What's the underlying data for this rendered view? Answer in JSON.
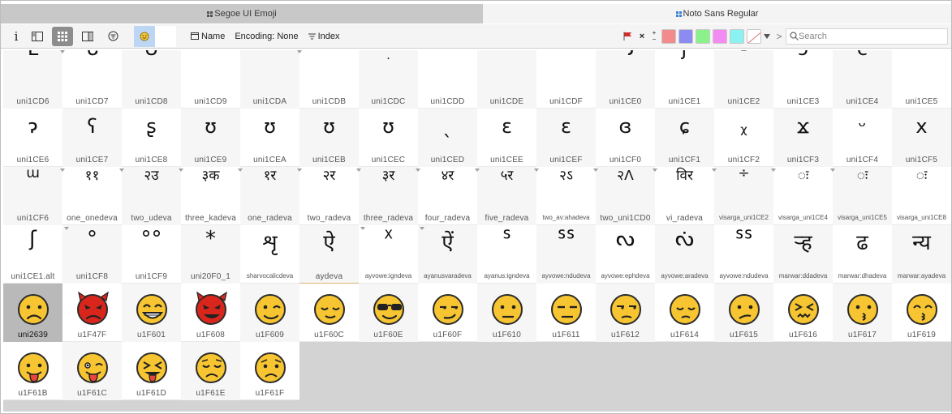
{
  "tabs": [
    {
      "label": "Segoe UI Emoji",
      "active": false
    },
    {
      "label": "Noto Sans Regular",
      "active": true
    }
  ],
  "toolbar": {
    "info_label": "i",
    "name_label": "Name",
    "encoding_label": "Encoding: None",
    "index_label": "Index",
    "plus_label": "+",
    "minus_label": "−",
    "close_label": "×",
    "next_label": ">",
    "search_placeholder": "Search",
    "swatch_colors": [
      "#f28b8b",
      "#8b8bf2",
      "#8bf28b",
      "#f28bf2",
      "#8bf2f2"
    ]
  },
  "colors": {
    "flag": "#d42a2a",
    "selected_cell": "#b9b9b9",
    "emoji_yellow": "#f7c531",
    "emoji_red": "#d9261c"
  },
  "rows": [
    [
      {
        "g": "ᒪ",
        "n": "uni1CD6"
      },
      {
        "g": "ᒐ",
        "n": "uni1CD7"
      },
      {
        "g": "ᑌ",
        "n": "uni1CD8"
      },
      {
        "g": "^",
        "n": "uni1CD9"
      },
      {
        "g": "\"",
        "n": "uni1CDA"
      },
      {
        "g": "‴",
        "n": "uni1CDB"
      },
      {
        "g": "ׅ",
        "n": "uni1CDC"
      },
      {
        "g": "·",
        "n": "uni1CDD"
      },
      {
        "g": "··",
        "n": "uni1CDE"
      },
      {
        "g": "···",
        "n": "uni1CDF"
      },
      {
        "g": "ᓓ",
        "n": "uni1CE0"
      },
      {
        "g": "ʃ",
        "n": "uni1CE1"
      },
      {
        "g": "-",
        "n": "uni1CE2"
      },
      {
        "g": "ɔ",
        "n": "uni1CE3"
      },
      {
        "g": "c",
        "n": "uni1CE4"
      },
      {
        "g": "ᑦ",
        "n": "uni1CE5"
      }
    ],
    [
      {
        "g": "ɂ",
        "n": "uni1CE6"
      },
      {
        "g": "ʕ",
        "n": "uni1CE7"
      },
      {
        "g": "ʂ",
        "n": "uni1CE8"
      },
      {
        "g": "ʊ",
        "n": "uni1CE9"
      },
      {
        "g": "ʊ",
        "n": "uni1CEA"
      },
      {
        "g": "ʊ",
        "n": "uni1CEB"
      },
      {
        "g": "ʊ",
        "n": "uni1CEC"
      },
      {
        "g": "ˎ",
        "n": "uni1CED"
      },
      {
        "g": "ɛ",
        "n": "uni1CEE"
      },
      {
        "g": "ɛ",
        "n": "uni1CEF"
      },
      {
        "g": "ɞ",
        "n": "uni1CF0"
      },
      {
        "g": "ɕ",
        "n": "uni1CF1"
      },
      {
        "g": "ᵪ",
        "n": "uni1CF2"
      },
      {
        "g": "ϫ",
        "n": "uni1CF3"
      },
      {
        "g": "ᵕ",
        "n": "uni1CF4"
      },
      {
        "g": "x",
        "n": "uni1CF5"
      }
    ],
    [
      {
        "g": "ɯ",
        "n": "uni1CF6"
      },
      {
        "g": "११",
        "n": "one_onedeva"
      },
      {
        "g": "२उ",
        "n": "two_udeva"
      },
      {
        "g": "३क",
        "n": "three_kadeva"
      },
      {
        "g": "१र",
        "n": "one_radeva"
      },
      {
        "g": "२र",
        "n": "two_radeva"
      },
      {
        "g": "३र",
        "n": "three_radeva"
      },
      {
        "g": "४र",
        "n": "four_radeva"
      },
      {
        "g": "५र",
        "n": "five_radeva"
      },
      {
        "g": "२ऽ",
        "n": "two_av:ahadeva"
      },
      {
        "g": "२ᐱ",
        "n": "two_uni1CD0"
      },
      {
        "g": "विर",
        "n": "vi_radeva"
      },
      {
        "g": "÷",
        "n": "visarga_uni1CE2"
      },
      {
        "g": "ः",
        "n": "visarga_uni1CE4"
      },
      {
        "g": "ः",
        "n": "visarga_uni1CE5"
      },
      {
        "g": "ः",
        "n": "visarga_uni1CE8"
      }
    ],
    [
      {
        "g": "ʃ",
        "n": "uni1CE1.alt"
      },
      {
        "g": "°",
        "n": "uni1CF8"
      },
      {
        "g": "°°",
        "n": "uni1CF9"
      },
      {
        "g": "*",
        "n": "uni20F0_1"
      },
      {
        "g": "शृ",
        "n": "sharvocalicdeva"
      },
      {
        "g": "ऐ",
        "n": "aydeva"
      },
      {
        "g": "ᕽ",
        "n": "ayvowe:igndeva"
      },
      {
        "g": "ऐं",
        "n": "ayanusvaradeva"
      },
      {
        "g": "ᔆ",
        "n": "ayanus:igndeva"
      },
      {
        "g": "ᔆᔆ",
        "n": "ayvowe:ndudeva"
      },
      {
        "g": "ᔓ",
        "n": "ayvowe:ephdeva"
      },
      {
        "g": "ᔔ",
        "n": "ayvowe:aradeva"
      },
      {
        "g": "ᔆᔆ",
        "n": "ayvowe:ndudeva"
      },
      {
        "g": "ऱ्ह",
        "n": "marwar:ddadeva"
      },
      {
        "g": "ढ",
        "n": "marwar:dhadeva"
      },
      {
        "g": "न्य",
        "n": "marwar:ayadeva"
      }
    ],
    [
      {
        "e": "frown",
        "n": "uni2639"
      },
      {
        "e": "devil",
        "n": "u1F47F"
      },
      {
        "e": "grin",
        "n": "u1F601"
      },
      {
        "e": "imp",
        "n": "u1F608"
      },
      {
        "e": "wink",
        "n": "u1F609"
      },
      {
        "e": "relieved",
        "n": "u1F60C"
      },
      {
        "e": "cool",
        "n": "u1F60E"
      },
      {
        "e": "smirk",
        "n": "u1F60F"
      },
      {
        "e": "neutral",
        "n": "u1F610"
      },
      {
        "e": "expressionless",
        "n": "u1F611"
      },
      {
        "e": "unamused",
        "n": "u1F612"
      },
      {
        "e": "pensive",
        "n": "u1F614"
      },
      {
        "e": "confused",
        "n": "u1F615"
      },
      {
        "e": "confounded",
        "n": "u1F616"
      },
      {
        "e": "kissing",
        "n": "u1F617"
      },
      {
        "e": "kissing-smile",
        "n": "u1F619"
      }
    ],
    [
      {
        "e": "tongue",
        "n": "u1F61B"
      },
      {
        "e": "tongue-wink",
        "n": "u1F61C"
      },
      {
        "e": "tongue-squint",
        "n": "u1F61D"
      },
      {
        "e": "disappointed",
        "n": "u1F61E"
      },
      {
        "e": "worried",
        "n": "u1F61F"
      }
    ]
  ]
}
